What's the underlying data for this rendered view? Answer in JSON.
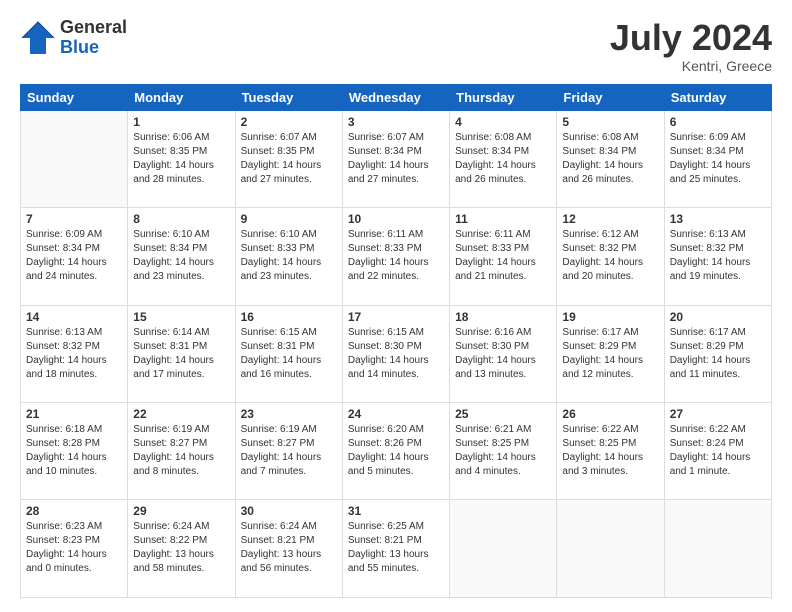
{
  "header": {
    "logo_line1": "General",
    "logo_line2": "Blue",
    "month": "July 2024",
    "location": "Kentri, Greece"
  },
  "weekdays": [
    "Sunday",
    "Monday",
    "Tuesday",
    "Wednesday",
    "Thursday",
    "Friday",
    "Saturday"
  ],
  "weeks": [
    [
      {
        "day": "",
        "info": ""
      },
      {
        "day": "1",
        "info": "Sunrise: 6:06 AM\nSunset: 8:35 PM\nDaylight: 14 hours\nand 28 minutes."
      },
      {
        "day": "2",
        "info": "Sunrise: 6:07 AM\nSunset: 8:35 PM\nDaylight: 14 hours\nand 27 minutes."
      },
      {
        "day": "3",
        "info": "Sunrise: 6:07 AM\nSunset: 8:34 PM\nDaylight: 14 hours\nand 27 minutes."
      },
      {
        "day": "4",
        "info": "Sunrise: 6:08 AM\nSunset: 8:34 PM\nDaylight: 14 hours\nand 26 minutes."
      },
      {
        "day": "5",
        "info": "Sunrise: 6:08 AM\nSunset: 8:34 PM\nDaylight: 14 hours\nand 26 minutes."
      },
      {
        "day": "6",
        "info": "Sunrise: 6:09 AM\nSunset: 8:34 PM\nDaylight: 14 hours\nand 25 minutes."
      }
    ],
    [
      {
        "day": "7",
        "info": "Sunrise: 6:09 AM\nSunset: 8:34 PM\nDaylight: 14 hours\nand 24 minutes."
      },
      {
        "day": "8",
        "info": "Sunrise: 6:10 AM\nSunset: 8:34 PM\nDaylight: 14 hours\nand 23 minutes."
      },
      {
        "day": "9",
        "info": "Sunrise: 6:10 AM\nSunset: 8:33 PM\nDaylight: 14 hours\nand 23 minutes."
      },
      {
        "day": "10",
        "info": "Sunrise: 6:11 AM\nSunset: 8:33 PM\nDaylight: 14 hours\nand 22 minutes."
      },
      {
        "day": "11",
        "info": "Sunrise: 6:11 AM\nSunset: 8:33 PM\nDaylight: 14 hours\nand 21 minutes."
      },
      {
        "day": "12",
        "info": "Sunrise: 6:12 AM\nSunset: 8:32 PM\nDaylight: 14 hours\nand 20 minutes."
      },
      {
        "day": "13",
        "info": "Sunrise: 6:13 AM\nSunset: 8:32 PM\nDaylight: 14 hours\nand 19 minutes."
      }
    ],
    [
      {
        "day": "14",
        "info": "Sunrise: 6:13 AM\nSunset: 8:32 PM\nDaylight: 14 hours\nand 18 minutes."
      },
      {
        "day": "15",
        "info": "Sunrise: 6:14 AM\nSunset: 8:31 PM\nDaylight: 14 hours\nand 17 minutes."
      },
      {
        "day": "16",
        "info": "Sunrise: 6:15 AM\nSunset: 8:31 PM\nDaylight: 14 hours\nand 16 minutes."
      },
      {
        "day": "17",
        "info": "Sunrise: 6:15 AM\nSunset: 8:30 PM\nDaylight: 14 hours\nand 14 minutes."
      },
      {
        "day": "18",
        "info": "Sunrise: 6:16 AM\nSunset: 8:30 PM\nDaylight: 14 hours\nand 13 minutes."
      },
      {
        "day": "19",
        "info": "Sunrise: 6:17 AM\nSunset: 8:29 PM\nDaylight: 14 hours\nand 12 minutes."
      },
      {
        "day": "20",
        "info": "Sunrise: 6:17 AM\nSunset: 8:29 PM\nDaylight: 14 hours\nand 11 minutes."
      }
    ],
    [
      {
        "day": "21",
        "info": "Sunrise: 6:18 AM\nSunset: 8:28 PM\nDaylight: 14 hours\nand 10 minutes."
      },
      {
        "day": "22",
        "info": "Sunrise: 6:19 AM\nSunset: 8:27 PM\nDaylight: 14 hours\nand 8 minutes."
      },
      {
        "day": "23",
        "info": "Sunrise: 6:19 AM\nSunset: 8:27 PM\nDaylight: 14 hours\nand 7 minutes."
      },
      {
        "day": "24",
        "info": "Sunrise: 6:20 AM\nSunset: 8:26 PM\nDaylight: 14 hours\nand 5 minutes."
      },
      {
        "day": "25",
        "info": "Sunrise: 6:21 AM\nSunset: 8:25 PM\nDaylight: 14 hours\nand 4 minutes."
      },
      {
        "day": "26",
        "info": "Sunrise: 6:22 AM\nSunset: 8:25 PM\nDaylight: 14 hours\nand 3 minutes."
      },
      {
        "day": "27",
        "info": "Sunrise: 6:22 AM\nSunset: 8:24 PM\nDaylight: 14 hours\nand 1 minute."
      }
    ],
    [
      {
        "day": "28",
        "info": "Sunrise: 6:23 AM\nSunset: 8:23 PM\nDaylight: 14 hours\nand 0 minutes."
      },
      {
        "day": "29",
        "info": "Sunrise: 6:24 AM\nSunset: 8:22 PM\nDaylight: 13 hours\nand 58 minutes."
      },
      {
        "day": "30",
        "info": "Sunrise: 6:24 AM\nSunset: 8:21 PM\nDaylight: 13 hours\nand 56 minutes."
      },
      {
        "day": "31",
        "info": "Sunrise: 6:25 AM\nSunset: 8:21 PM\nDaylight: 13 hours\nand 55 minutes."
      },
      {
        "day": "",
        "info": ""
      },
      {
        "day": "",
        "info": ""
      },
      {
        "day": "",
        "info": ""
      }
    ]
  ]
}
